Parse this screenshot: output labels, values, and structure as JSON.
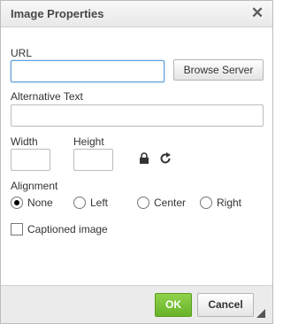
{
  "dialog": {
    "title": "Image Properties",
    "close_icon": "close-icon"
  },
  "url": {
    "label": "URL",
    "value": "",
    "browse_label": "Browse Server"
  },
  "alt": {
    "label": "Alternative Text",
    "value": ""
  },
  "size": {
    "width_label": "Width",
    "width_value": "",
    "height_label": "Height",
    "height_value": "",
    "lock_icon": "lock-icon",
    "reset_icon": "reset-size-icon"
  },
  "alignment": {
    "label": "Alignment",
    "selected": "None",
    "options": [
      "None",
      "Left",
      "Center",
      "Right"
    ]
  },
  "captioned": {
    "label": "Captioned image",
    "checked": false
  },
  "footer": {
    "ok_label": "OK",
    "cancel_label": "Cancel",
    "resize_icon": "resize-handle-icon"
  },
  "colors": {
    "ok_button": "#6fbb2d",
    "focus_border": "#5c9ed6"
  }
}
